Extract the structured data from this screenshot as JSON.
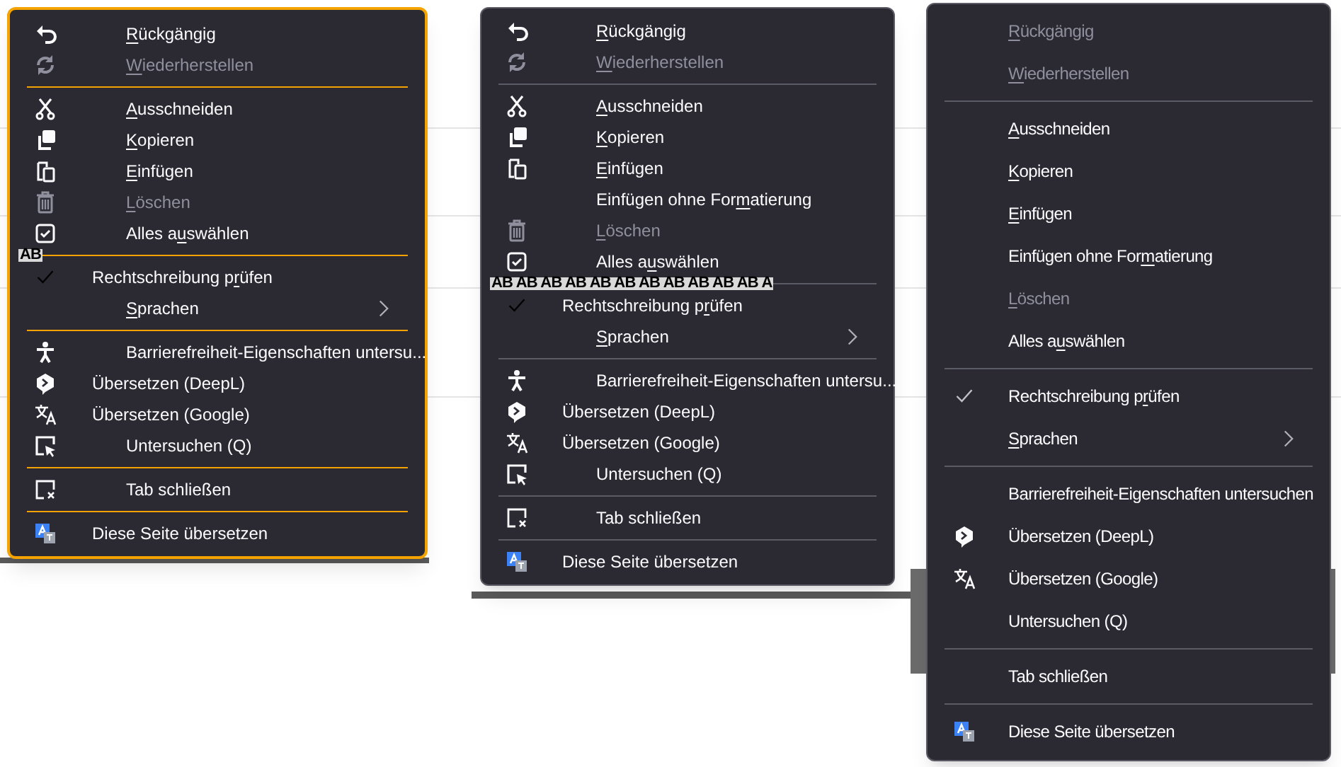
{
  "menus": [
    {
      "highlighted": true,
      "entries": [
        {
          "kind": "item",
          "label_parts": {
            "key": "R",
            "after": "ückgängig"
          },
          "disabled": false
        },
        {
          "kind": "item",
          "label_parts": {
            "key": "W",
            "after": "iederherstellen"
          },
          "disabled": true
        },
        {
          "kind": "separator"
        },
        {
          "kind": "item",
          "label_parts": {
            "key": "A",
            "after": "usschneiden"
          },
          "disabled": false
        },
        {
          "kind": "item",
          "label_parts": {
            "key": "K",
            "after": "opieren"
          },
          "disabled": false
        },
        {
          "kind": "item",
          "label_parts": {
            "key": "E",
            "after": "infügen"
          },
          "disabled": false
        },
        {
          "kind": "item",
          "label_parts": {
            "key": "L",
            "after": "öschen"
          },
          "disabled": true
        },
        {
          "kind": "item",
          "label_parts": {
            "before": "Alles a",
            "key": "u",
            "after": "swählen"
          },
          "disabled": false
        },
        {
          "kind": "separator"
        },
        {
          "kind": "check",
          "label_parts": {
            "before": "Rechtschreibung p",
            "key": "r",
            "after": "üfen"
          },
          "checked": true,
          "icon_text": "AB"
        },
        {
          "kind": "submenu",
          "label_parts": {
            "key": "S",
            "after": "prachen"
          },
          "disabled": false
        },
        {
          "kind": "separator"
        },
        {
          "kind": "item",
          "label": "Barrierefreiheit-Eigenschaften untersu...",
          "disabled": false
        },
        {
          "kind": "item",
          "label": "Übersetzen (DeepL)",
          "disabled": false
        },
        {
          "kind": "item",
          "label": "Übersetzen (Google)",
          "disabled": false
        },
        {
          "kind": "item",
          "label": "Untersuchen (Q)",
          "disabled": false
        },
        {
          "kind": "separator"
        },
        {
          "kind": "item",
          "label": "Tab schließen",
          "disabled": false
        },
        {
          "kind": "separator"
        },
        {
          "kind": "item",
          "label": "Diese Seite übersetzen",
          "disabled": false
        }
      ]
    },
    {
      "highlighted": false,
      "entries": [
        {
          "kind": "item",
          "label_parts": {
            "key": "R",
            "after": "ückgängig"
          },
          "disabled": false
        },
        {
          "kind": "item",
          "label_parts": {
            "key": "W",
            "after": "iederherstellen"
          },
          "disabled": true
        },
        {
          "kind": "separator"
        },
        {
          "kind": "item",
          "label_parts": {
            "key": "A",
            "after": "usschneiden"
          },
          "disabled": false
        },
        {
          "kind": "item",
          "label_parts": {
            "key": "K",
            "after": "opieren"
          },
          "disabled": false
        },
        {
          "kind": "item",
          "label_parts": {
            "key": "E",
            "after": "infügen"
          },
          "disabled": false
        },
        {
          "kind": "item",
          "label_parts": {
            "before": "Einfügen ohne For",
            "key": "m",
            "after": "atierung"
          },
          "disabled": false
        },
        {
          "kind": "item",
          "label_parts": {
            "key": "L",
            "after": "öschen"
          },
          "disabled": true
        },
        {
          "kind": "item",
          "label_parts": {
            "before": "Alles a",
            "key": "u",
            "after": "swählen"
          },
          "disabled": false
        },
        {
          "kind": "separator"
        },
        {
          "kind": "check",
          "label_parts": {
            "before": "Rechtschreibung p",
            "key": "r",
            "after": "üfen"
          },
          "checked": true,
          "icon_text": "AB AB AB AB AB AB AB AB AB AB AB A"
        },
        {
          "kind": "submenu",
          "label_parts": {
            "key": "S",
            "after": "prachen"
          },
          "disabled": false
        },
        {
          "kind": "separator"
        },
        {
          "kind": "item",
          "label": "Barrierefreiheit-Eigenschaften untersu...",
          "disabled": false
        },
        {
          "kind": "item",
          "label": "Übersetzen (DeepL)",
          "disabled": false
        },
        {
          "kind": "item",
          "label": "Übersetzen (Google)",
          "disabled": false
        },
        {
          "kind": "item",
          "label": "Untersuchen (Q)",
          "disabled": false
        },
        {
          "kind": "separator"
        },
        {
          "kind": "item",
          "label": "Tab schließen",
          "disabled": false
        },
        {
          "kind": "separator"
        },
        {
          "kind": "item",
          "label": "Diese Seite übersetzen",
          "disabled": false
        }
      ]
    },
    {
      "highlighted": false,
      "entries": [
        {
          "kind": "item",
          "label_parts": {
            "key": "R",
            "after": "ückgängig"
          },
          "disabled": true
        },
        {
          "kind": "item",
          "label_parts": {
            "key": "W",
            "after": "iederherstellen"
          },
          "disabled": true
        },
        {
          "kind": "separator"
        },
        {
          "kind": "item",
          "label_parts": {
            "key": "A",
            "after": "usschneiden"
          },
          "disabled": false
        },
        {
          "kind": "item",
          "label_parts": {
            "key": "K",
            "after": "opieren"
          },
          "disabled": false
        },
        {
          "kind": "item",
          "label_parts": {
            "key": "E",
            "after": "infügen"
          },
          "disabled": false
        },
        {
          "kind": "item",
          "label_parts": {
            "before": "Einfügen ohne For",
            "key": "m",
            "after": "atierung"
          },
          "disabled": false
        },
        {
          "kind": "item",
          "label_parts": {
            "key": "L",
            "after": "öschen"
          },
          "disabled": true
        },
        {
          "kind": "item",
          "label_parts": {
            "before": "Alles a",
            "key": "u",
            "after": "swählen"
          },
          "disabled": false
        },
        {
          "kind": "separator"
        },
        {
          "kind": "check",
          "label_parts": {
            "before": "Rechtschreibung p",
            "key": "r",
            "after": "üfen"
          },
          "checked": true
        },
        {
          "kind": "submenu",
          "label_parts": {
            "key": "S",
            "after": "prachen"
          },
          "disabled": false
        },
        {
          "kind": "separator"
        },
        {
          "kind": "item",
          "label": "Barrierefreiheit-Eigenschaften untersuchen",
          "disabled": false
        },
        {
          "kind": "item",
          "label": "Übersetzen (DeepL)",
          "disabled": false
        },
        {
          "kind": "item",
          "label": "Übersetzen (Google)",
          "disabled": false
        },
        {
          "kind": "item",
          "label": "Untersuchen (Q)",
          "disabled": false
        },
        {
          "kind": "separator"
        },
        {
          "kind": "item",
          "label": "Tab schließen",
          "disabled": false
        },
        {
          "kind": "separator"
        },
        {
          "kind": "item",
          "label": "Diese Seite übersetzen",
          "disabled": false
        }
      ]
    }
  ]
}
